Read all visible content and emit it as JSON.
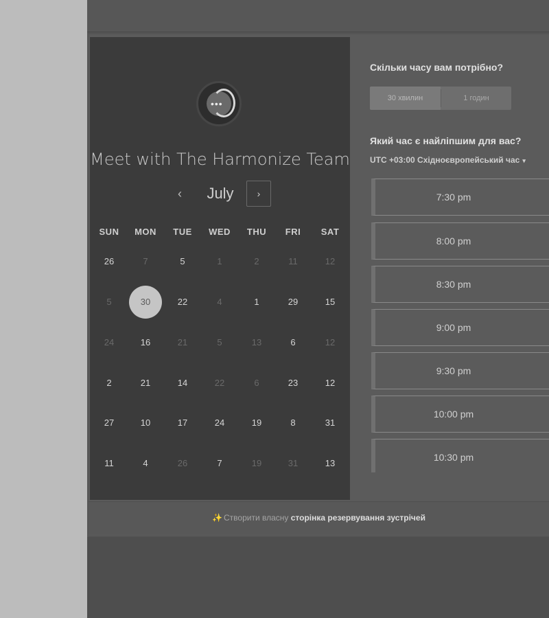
{
  "calendar": {
    "title": "Meet with The Harmonize Team",
    "month": "July",
    "prev_icon": "‹",
    "next_icon": "›",
    "weekdays": [
      "SUN",
      "MON",
      "TUE",
      "WED",
      "THU",
      "FRI",
      "SAT"
    ],
    "weeks": [
      [
        {
          "d": "26",
          "muted": false
        },
        {
          "d": "7",
          "muted": true
        },
        {
          "d": "5",
          "muted": false
        },
        {
          "d": "1",
          "muted": true
        },
        {
          "d": "2",
          "muted": true
        },
        {
          "d": "11",
          "muted": true
        },
        {
          "d": "12",
          "muted": true
        }
      ],
      [
        {
          "d": "5",
          "muted": true
        },
        {
          "d": "30",
          "muted": false,
          "selected": true
        },
        {
          "d": "22",
          "muted": false
        },
        {
          "d": "4",
          "muted": true
        },
        {
          "d": "1",
          "muted": false
        },
        {
          "d": "29",
          "muted": false
        },
        {
          "d": "15",
          "muted": false
        }
      ],
      [
        {
          "d": "24",
          "muted": true
        },
        {
          "d": "16",
          "muted": false
        },
        {
          "d": "21",
          "muted": true
        },
        {
          "d": "5",
          "muted": true
        },
        {
          "d": "13",
          "muted": true
        },
        {
          "d": "6",
          "muted": false
        },
        {
          "d": "12",
          "muted": true
        }
      ],
      [
        {
          "d": "2",
          "muted": false
        },
        {
          "d": "21",
          "muted": false
        },
        {
          "d": "14",
          "muted": false
        },
        {
          "d": "22",
          "muted": true
        },
        {
          "d": "6",
          "muted": true
        },
        {
          "d": "23",
          "muted": false
        },
        {
          "d": "12",
          "muted": false
        }
      ],
      [
        {
          "d": "27",
          "muted": false
        },
        {
          "d": "10",
          "muted": false
        },
        {
          "d": "17",
          "muted": false
        },
        {
          "d": "24",
          "muted": false
        },
        {
          "d": "19",
          "muted": false
        },
        {
          "d": "8",
          "muted": false
        },
        {
          "d": "31",
          "muted": false
        }
      ],
      [
        {
          "d": "11",
          "muted": false
        },
        {
          "d": "4",
          "muted": false
        },
        {
          "d": "26",
          "muted": true
        },
        {
          "d": "7",
          "muted": false
        },
        {
          "d": "19",
          "muted": true
        },
        {
          "d": "31",
          "muted": true
        },
        {
          "d": "13",
          "muted": false
        }
      ]
    ]
  },
  "booking": {
    "duration_question": "Скільки часу вам потрібно?",
    "durations": [
      {
        "label": "30 хвилин",
        "active": true
      },
      {
        "label": "1 годин",
        "active": false
      }
    ],
    "time_question": "Який час є найліпшим для вас?",
    "timezone": "UTC +03:00 Східноєвропейський час",
    "timezone_caret": "▾",
    "slots": [
      "7:30 pm",
      "8:00 pm",
      "8:30 pm",
      "9:00 pm",
      "9:30 pm",
      "10:00 pm",
      "10:30 pm"
    ]
  },
  "footer": {
    "icon": "✨",
    "prefix": "Створити власну",
    "link": "сторінка резервування зустрічей"
  },
  "colors": {
    "selected_day_bg": "#c5c5c5",
    "calendar_bg": "#3b3b3b",
    "page_bg": "#555555"
  }
}
